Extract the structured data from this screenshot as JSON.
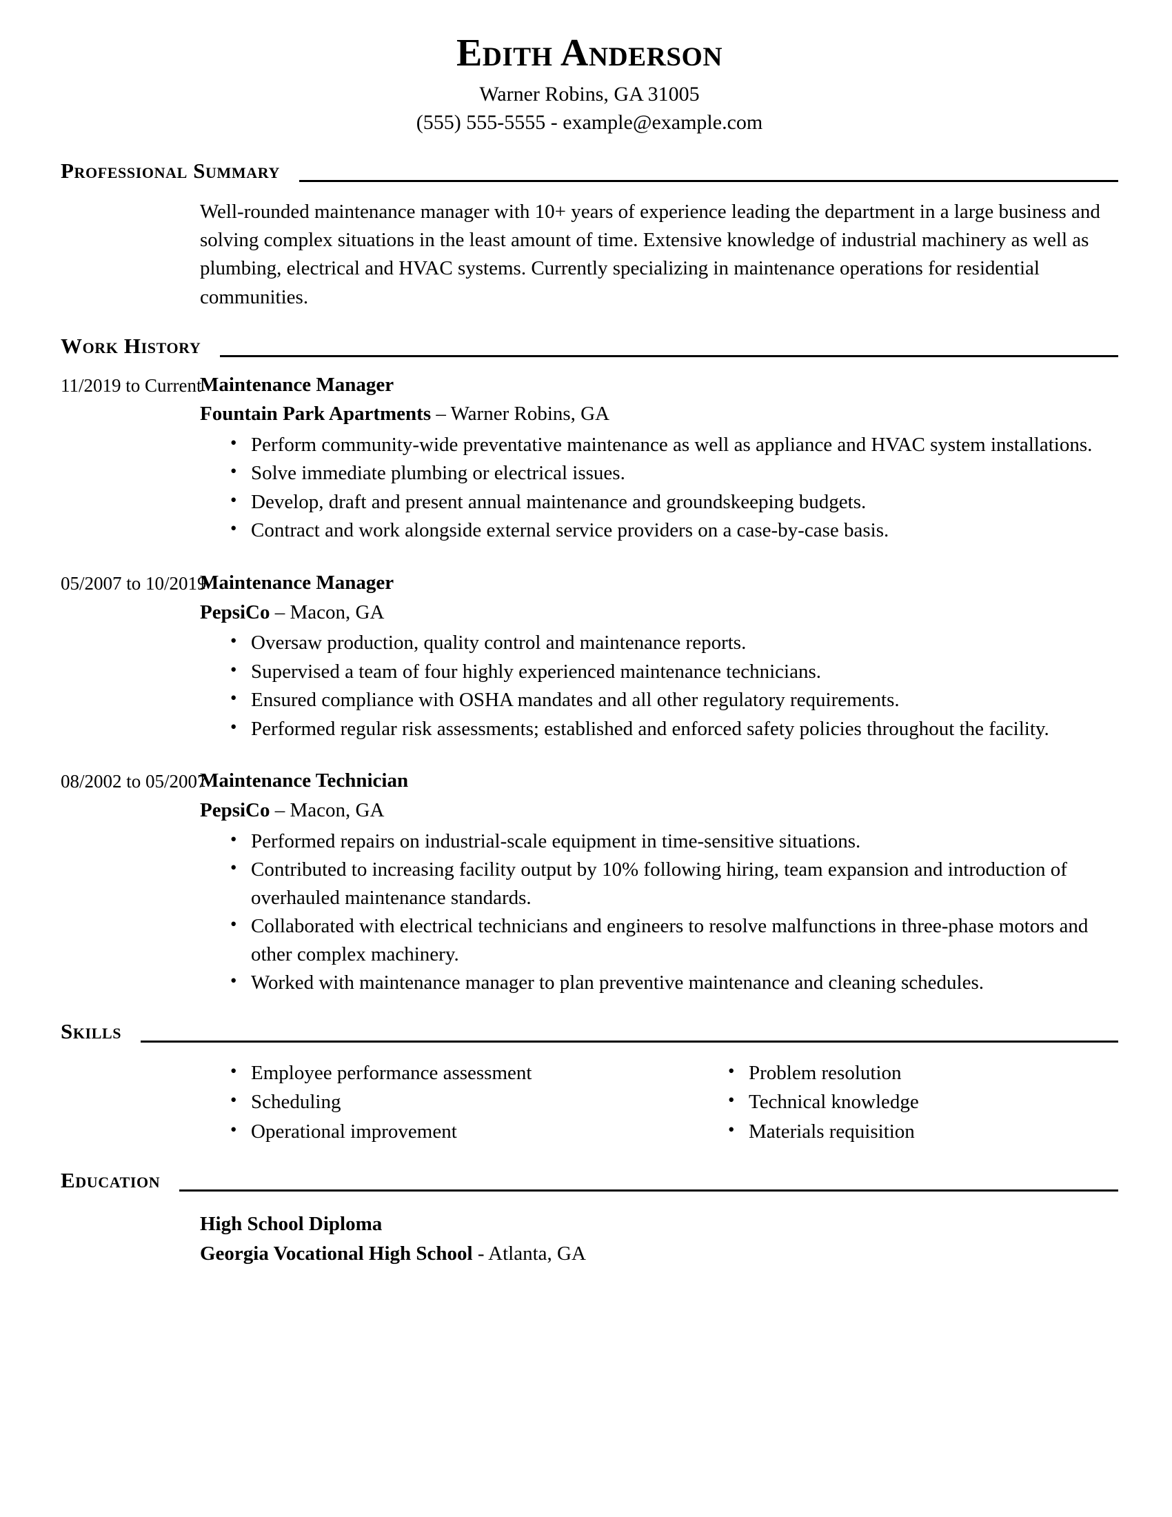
{
  "header": {
    "name": "Edith Anderson",
    "address": "Warner Robins, GA 31005",
    "contact": "(555) 555-5555 - example@example.com"
  },
  "summary": {
    "title": "Professional Summary",
    "text": "Well-rounded maintenance manager with 10+ years of experience leading the department in a large business and solving complex situations in the least amount of time. Extensive knowledge of industrial machinery as well as plumbing, electrical and HVAC systems. Currently specializing in maintenance operations for residential communities."
  },
  "work_history": {
    "title": "Work History",
    "jobs": [
      {
        "dates": "11/2019 to Current",
        "title": "Maintenance Manager",
        "organization": "Fountain Park Apartments",
        "separator": "–",
        "location": "Warner Robins, GA",
        "bullets": [
          "Perform community-wide preventative maintenance as well as appliance and HVAC system installations.",
          "Solve immediate plumbing or electrical issues.",
          "Develop, draft and present annual maintenance and groundskeeping budgets.",
          "Contract and work alongside external service providers on a case-by-case basis."
        ]
      },
      {
        "dates": "05/2007 to 10/2019",
        "title": "Maintenance Manager",
        "organization": "PepsiCo",
        "separator": "–",
        "location": "Macon, GA",
        "bullets": [
          "Oversaw production, quality control and maintenance reports.",
          "Supervised a team of four highly experienced maintenance technicians.",
          "Ensured compliance with OSHA mandates and all other regulatory requirements.",
          "Performed regular risk assessments; established and enforced safety policies throughout the facility."
        ]
      },
      {
        "dates": "08/2002 to 05/2007",
        "title": "Maintenance Technician",
        "organization": "PepsiCo",
        "separator": "–",
        "location": "Macon, GA",
        "bullets": [
          "Performed repairs on industrial-scale equipment in time-sensitive situations.",
          "Contributed to increasing facility output by 10% following hiring, team expansion and introduction of overhauled maintenance standards.",
          "Collaborated with electrical technicians and engineers to resolve malfunctions in three-phase motors and other complex machinery.",
          "Worked with maintenance manager to plan preventive maintenance and cleaning schedules."
        ]
      }
    ]
  },
  "skills": {
    "title": "Skills",
    "left_column": [
      "Employee performance assessment",
      "Scheduling",
      "Operational improvement"
    ],
    "right_column": [
      "Problem resolution",
      "Technical knowledge",
      "Materials requisition"
    ]
  },
  "education": {
    "title": "Education",
    "degree": "High School Diploma",
    "school": "Georgia Vocational High School",
    "separator": "-",
    "location": "Atlanta, GA"
  }
}
